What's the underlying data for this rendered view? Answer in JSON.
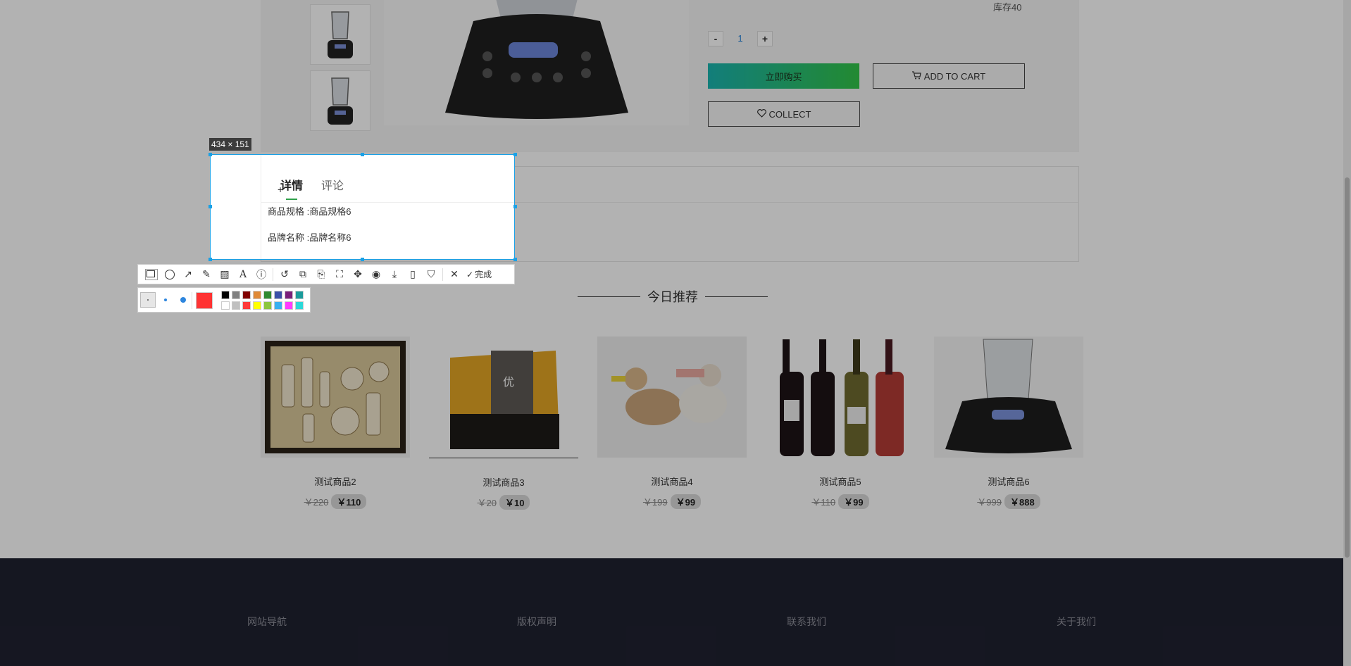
{
  "product": {
    "stock": "库存40",
    "qty_minus": "-",
    "qty_value": "1",
    "qty_plus": "+",
    "buy_now": "立即购买",
    "add_to_cart": "ADD TO CART",
    "collect": "COLLECT"
  },
  "detail": {
    "tabs": [
      "详情",
      "评论"
    ],
    "specs": [
      {
        "label": "商品规格",
        "value": "商品规格6"
      },
      {
        "label": "品牌名称",
        "value": "品牌名称6"
      }
    ],
    "spec_text_1": "商品规格 :商品规格6",
    "spec_text_2": "品牌名称 :品牌名称6"
  },
  "recommend": {
    "title": "今日推荐",
    "products": [
      {
        "name": "测试商品2",
        "old_price": "￥220",
        "price": "￥110"
      },
      {
        "name": "测试商品3",
        "old_price": "￥20",
        "price": "￥10"
      },
      {
        "name": "测试商品4",
        "old_price": "￥199",
        "price": "￥99"
      },
      {
        "name": "测试商品5",
        "old_price": "￥110",
        "price": "￥99"
      },
      {
        "name": "测试商品6",
        "old_price": "￥999",
        "price": "￥888"
      }
    ]
  },
  "footer": {
    "links": [
      "网站导航",
      "版权声明",
      "联系我们",
      "关于我们"
    ]
  },
  "capture": {
    "size_label": "434 × 151",
    "done_label": "完成",
    "tools": [
      "rectangle-icon",
      "ellipse-icon",
      "arrow-icon",
      "pen-icon",
      "mosaic-icon",
      "text-icon",
      "number-icon",
      "undo-icon",
      "ocr-icon",
      "translate-icon",
      "scroll-capture-icon",
      "pin-icon",
      "record-icon",
      "download-icon",
      "phone-icon",
      "bookmark-icon",
      "close-icon"
    ],
    "current_color": "#ff3333",
    "swatches_top": [
      "#000000",
      "#808080",
      "#800000",
      "#e08a36",
      "#2f8a2f",
      "#3a4fa8",
      "#7a1e7a",
      "#1a9a9a"
    ],
    "swatches_bottom": [
      "#ffffff",
      "#c0c0c0",
      "#ff3b3b",
      "#ffff00",
      "#8cc63f",
      "#3ab0f0",
      "#ff3bff",
      "#2bd8d8"
    ]
  },
  "colors": {
    "selection_border": "#1aa1e6",
    "tab_accent": "#2fa14b"
  }
}
